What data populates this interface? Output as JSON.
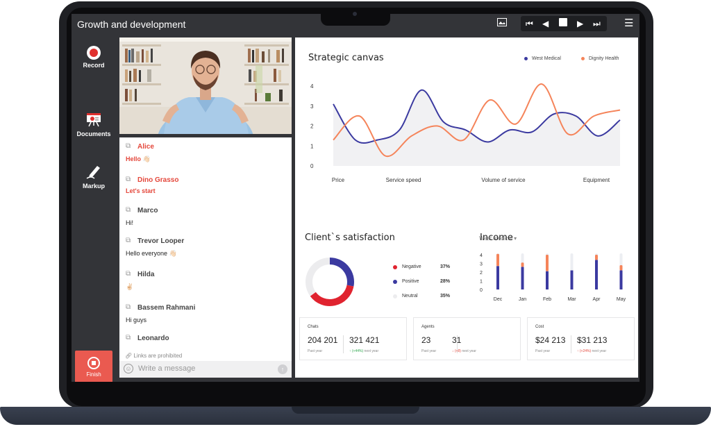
{
  "app": {
    "title": "Growth and development",
    "toolbar_icons": [
      "image-icon",
      "skip-back-icon",
      "previous-icon",
      "stop-icon",
      "play-icon",
      "skip-forward-icon",
      "menu-icon"
    ]
  },
  "rail": {
    "record_label": "Record",
    "documents_label": "Documents",
    "markup_label": "Markup",
    "finish_label": "Finish"
  },
  "chat": {
    "messages": [
      {
        "name": "Alice",
        "text": "Hello 👋🏻",
        "highlight": true
      },
      {
        "name": "Dino Grasso",
        "text": "Let's start",
        "highlight": true
      },
      {
        "name": "Marco",
        "text": "Hi!",
        "highlight": false
      },
      {
        "name": "Trevor Looper",
        "text": "Hello everyone 👋🏻",
        "highlight": false
      },
      {
        "name": "Hilda",
        "text": "✌🏻",
        "highlight": false
      },
      {
        "name": "Bassem Rahmani",
        "text": "Hi guys",
        "highlight": false
      },
      {
        "name": "Leonardo",
        "text": "",
        "highlight": false
      }
    ],
    "links_notice": "Links are prohibited",
    "composer_placeholder": "Write a message"
  },
  "strategic": {
    "title": "Strategic canvas",
    "legend": [
      "West Medical",
      "Dignity Health"
    ]
  },
  "satisfaction": {
    "title": "Client`s satisfaction",
    "filter": "West medical",
    "rows": [
      {
        "label": "Negative",
        "pct": "37%"
      },
      {
        "label": "Positive",
        "pct": "28%"
      },
      {
        "label": "Neutral",
        "pct": "35%"
      }
    ]
  },
  "income": {
    "title": "Income"
  },
  "cards": [
    {
      "title": "Chats",
      "v1": "204 201",
      "s1": "Past year",
      "v2": "321 421",
      "delta": "↑ (+44%)",
      "s2": "next year",
      "dir": "up"
    },
    {
      "title": "Agents",
      "v1": "23",
      "s1": "Past year",
      "v2": "31",
      "delta": "↓ (+8)",
      "s2": "next year",
      "dir": "down"
    },
    {
      "title": "Cost",
      "v1": "$24 213",
      "s1": "Past year",
      "v2": "$31 213",
      "delta": "↑ (+24%)",
      "s2": "next year",
      "dir": "down"
    }
  ],
  "colors": {
    "west": "#3b3aa0",
    "dignity": "#f5845a",
    "negative": "#e0232f",
    "neutral": "#ececee",
    "income_stack": "#f5845a",
    "income_track": "#eceef2"
  },
  "chart_data": [
    {
      "type": "line",
      "title": "Strategic canvas",
      "categories": [
        "Price",
        "Service speed",
        "Volume of service",
        "Equipment"
      ],
      "ylim": [
        0,
        4
      ],
      "yticks": [
        0,
        1,
        2,
        3,
        4
      ],
      "legend_position": "top-right",
      "smooth": true,
      "x": [
        0,
        0.5,
        1,
        1.5,
        2,
        2.5,
        3,
        3.5,
        4,
        4.5,
        5,
        5.5,
        6,
        6.5,
        7,
        7.5,
        8,
        8.5,
        9
      ],
      "series": [
        {
          "name": "West Medical",
          "values": [
            3.1,
            1.3,
            1.3,
            1.8,
            3.8,
            2.2,
            1.8,
            1.2,
            1.8,
            1.7,
            2.6,
            2.5,
            1.5,
            2.3
          ]
        },
        {
          "name": "Dignity Health",
          "values": [
            1.3,
            2.5,
            0.5,
            1.5,
            2.0,
            1.3,
            3.3,
            2.1,
            4.1,
            1.6,
            2.5,
            2.8
          ]
        }
      ]
    },
    {
      "type": "pie",
      "title": "Client`s satisfaction",
      "categories": [
        "Negative",
        "Positive",
        "Neutral"
      ],
      "values": [
        37,
        28,
        35
      ],
      "donut": true
    },
    {
      "type": "bar",
      "title": "Income",
      "categories": [
        "Dec",
        "Jan",
        "Feb",
        "Mar",
        "Apr",
        "May"
      ],
      "ylim": [
        0,
        4
      ],
      "yticks": [
        0,
        1,
        2,
        3,
        4
      ],
      "stacked": true,
      "series": [
        {
          "values": [
            2.7,
            2.6,
            2.1,
            2.2,
            3.4,
            2.2
          ]
        },
        {
          "values": [
            1.4,
            0.5,
            1.9,
            0,
            0.6,
            0.6
          ]
        }
      ]
    }
  ]
}
